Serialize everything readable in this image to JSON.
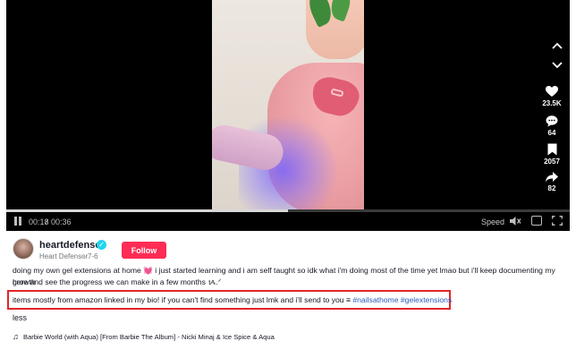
{
  "player": {
    "time_current": "00:18",
    "time_separator": "/",
    "time_total": "00:36",
    "progress_fraction": 0.5,
    "speed_label": "Speed"
  },
  "actions": {
    "likes": "23.5K",
    "comments": "64",
    "saves": "2057",
    "shares": "82"
  },
  "author": {
    "username": "heartdefensor",
    "nickname": "Heart Defensor",
    "separator": "·",
    "date": "7-6",
    "follow_label": "Follow"
  },
  "caption": {
    "line1": "doing my own gel extensions at home 💓 i just started learning and i am self taught so idk what i'm doing most of the time yet lmao but i'll keep documenting my growth",
    "line2": "here and see the progress we can make in a few months ᝰ.ᐟ",
    "line3_text": "items mostly from amazon linked in my bio! if you can't find something just lmk and i'll send to you ≡ ",
    "hashtag1": "#nailsathome",
    "hashtag2": "#gelextensions",
    "less_label": "less"
  },
  "music": {
    "icon": "♫",
    "title": "Barbie World (with Aqua) [From Barbie The Album] - Nicki Minaj & Ice Spice & Aqua"
  },
  "colors": {
    "follow_button": "#fe2c55",
    "highlight_border": "#e0262b",
    "hashtag": "#2b5db9",
    "verified": "#20d5ec"
  }
}
